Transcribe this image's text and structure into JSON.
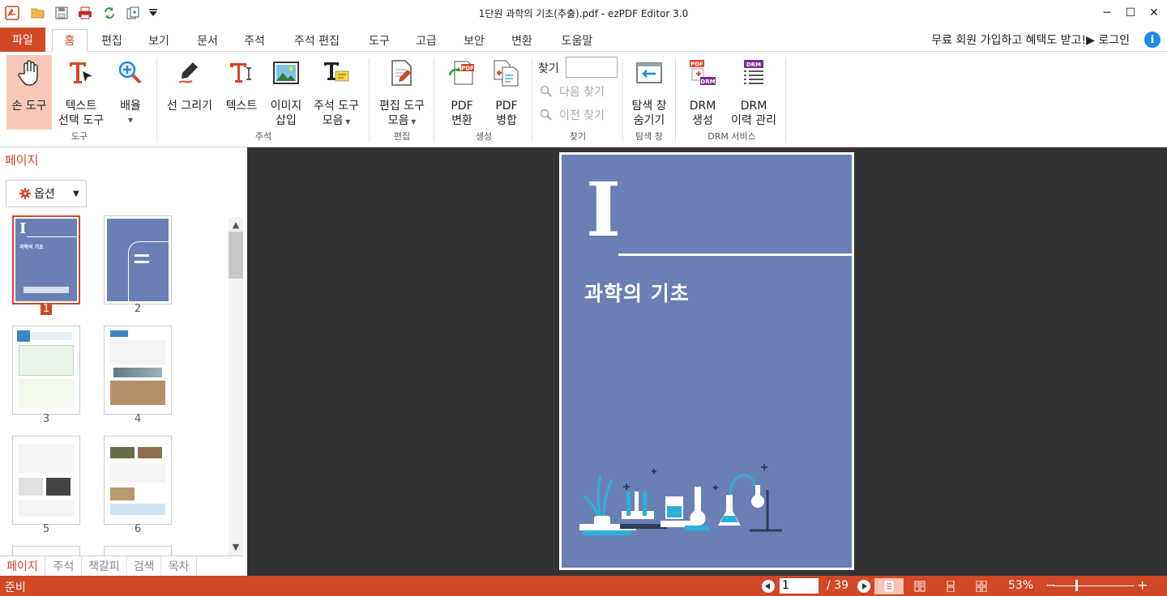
{
  "window": {
    "title": "1단원 과학의 기초(추출).pdf - ezPDF Editor 3.0"
  },
  "tabs": {
    "file": "파일",
    "items": [
      "홈",
      "편집",
      "보기",
      "문서",
      "주석",
      "주석 편집",
      "도구",
      "고급",
      "보안",
      "변환",
      "도움말"
    ],
    "active": "홈"
  },
  "promo": "무료 회원 가입하고 혜택도 받고!▶ 로그인",
  "info_icon": "i",
  "ribbon": {
    "hand_tool": "손 도구",
    "text_select_1": "텍스트",
    "text_select_2": "선택 도구",
    "zoom_1": "배율",
    "group_tools": "도구",
    "line_draw": "선 그리기",
    "text": "텍스트",
    "image_insert_1": "이미지",
    "image_insert_2": "삽입",
    "annot_tools_1": "주석 도구",
    "annot_tools_2": "모음",
    "group_annot": "주석",
    "edit_tools_1": "편집 도구",
    "edit_tools_2": "모음",
    "group_edit": "편집",
    "pdf_convert_1": "PDF",
    "pdf_convert_2": "변환",
    "pdf_merge_1": "PDF",
    "pdf_merge_2": "병합",
    "group_create": "생성",
    "find_label": "찾기",
    "find_next": "다음 찾기",
    "find_prev": "이전 찾기",
    "group_find": "찾기",
    "nav_hide_1": "탐색 창",
    "nav_hide_2": "숨기기",
    "group_nav": "탐색 창",
    "drm_create_1": "DRM",
    "drm_create_2": "생성",
    "drm_history_1": "DRM",
    "drm_history_2": "이력 관리",
    "group_drm": "DRM 서비스",
    "badge_pdf": "PDF",
    "badge_drm": "DRM"
  },
  "sidebar": {
    "title": "페이지",
    "options": "옵션",
    "thumbnails": [
      "1",
      "2",
      "3",
      "4",
      "5",
      "6"
    ],
    "thumb1_title": "과학의 기초",
    "bottom_tabs": [
      "페이지",
      "주석",
      "책갈피",
      "검색",
      "목차"
    ]
  },
  "document": {
    "chapter_numeral": "I",
    "chapter_title": "과학의 기초"
  },
  "status": {
    "ready": "준비",
    "current_page": "1",
    "total_pages": "/ 39",
    "zoom": "53%",
    "zoom_minus": "−",
    "zoom_plus": "+"
  },
  "colors": {
    "accent": "#d24726",
    "cover_blue": "#6a80b4",
    "viewer_bg": "#333333"
  }
}
